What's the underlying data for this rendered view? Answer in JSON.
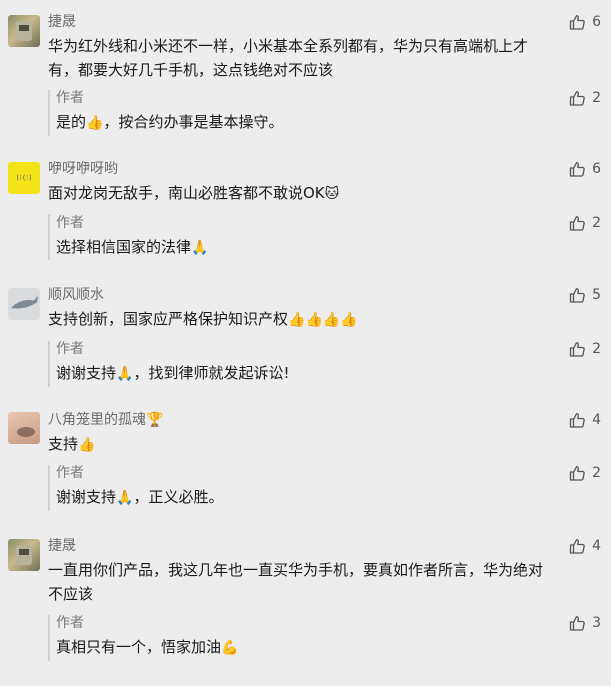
{
  "comments": [
    {
      "nickname": "捷晟",
      "text_line1": "华为红外线和小米还不一样，小米基本全系列都有，华为只有高端机上才",
      "text_line2": "有，都要大好几千手机，这点钱绝对不应该",
      "likes": "6",
      "reply": {
        "author": "作者",
        "text_a": "是的",
        "emoji_a": "👍",
        "text_b": "，按合约办事是基本操守。",
        "likes": "2"
      }
    },
    {
      "nickname": "咿呀咿呀哟",
      "avatar_text": "(⁝(⁝)",
      "text_a": "面对龙岗无敌手，南山必胜客都不敢说OK",
      "emoji_a": "🐱",
      "likes": "6",
      "reply": {
        "author": "作者",
        "text_a": "选择相信国家的法律",
        "emoji_a": "🙏",
        "likes": "2"
      }
    },
    {
      "nickname": "顺风顺水",
      "text_a": "支持创新，国家应严格保护知识产权",
      "emoji_a": "👍👍👍👍",
      "likes": "5",
      "reply": {
        "author": "作者",
        "text_a": "谢谢支持",
        "emoji_a": "🙏",
        "text_b": "，找到律师就发起诉讼!",
        "likes": "2"
      }
    },
    {
      "nickname": "八角笼里的孤魂",
      "nick_emoji": "🏆",
      "text_a": "支持",
      "emoji_a": "👍",
      "likes": "4",
      "reply": {
        "author": "作者",
        "text_a": "谢谢支持",
        "emoji_a": "🙏",
        "text_b": "，正义必胜。",
        "likes": "2"
      }
    },
    {
      "nickname": "捷晟",
      "text_line1": "一直用你们产品，我这几年也一直买华为手机，要真如作者所言，华为绝对",
      "text_line2": "不应该",
      "likes": "4",
      "reply": {
        "author": "作者",
        "text_a": "真相只有一个，悟家加油",
        "emoji_a": "💪",
        "likes": "3"
      }
    }
  ],
  "icons": {
    "like": "thumbs-up-outline-icon"
  },
  "colors": {
    "background": "#ededed",
    "nickname": "#6b6b6b",
    "reply_bar": "#d0d0d0"
  }
}
